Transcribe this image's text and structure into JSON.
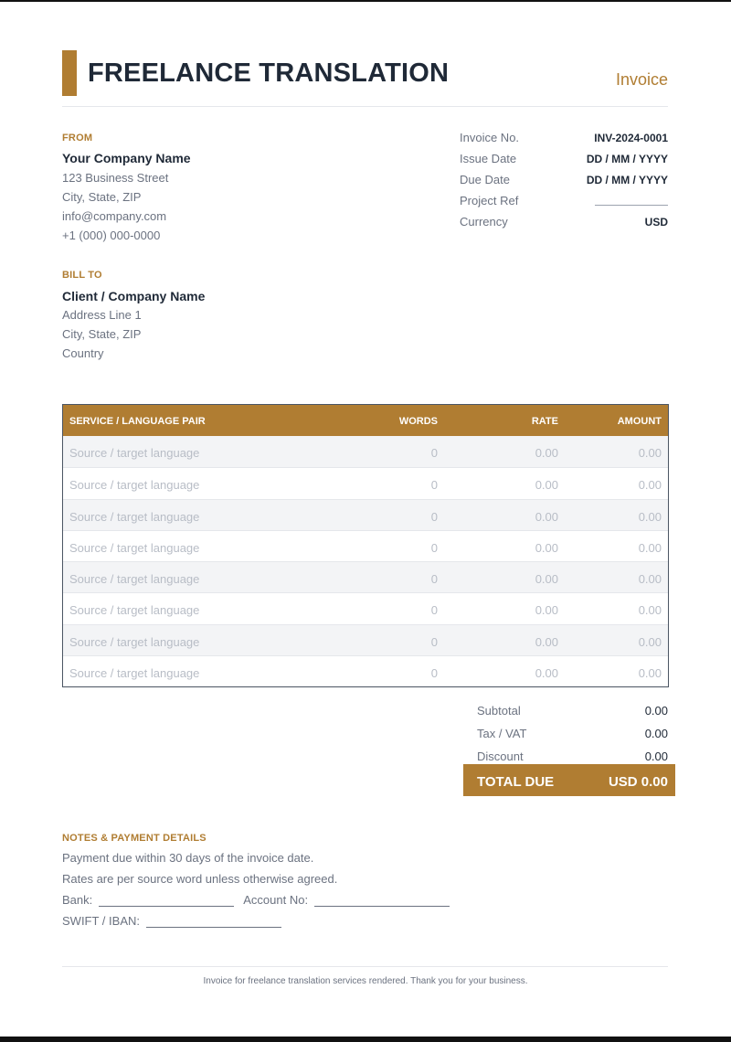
{
  "header": {
    "title": "FREELANCE TRANSLATION",
    "doc_label": "Invoice"
  },
  "from": {
    "label": "FROM",
    "name": "Your Company Name",
    "lines": [
      "123 Business Street",
      "City, State, ZIP",
      "info@company.com",
      "+1 (000) 000-0000"
    ]
  },
  "bill_to": {
    "label": "BILL TO",
    "name": "Client / Company Name",
    "lines": [
      "Address Line 1",
      "City, State, ZIP",
      "Country"
    ]
  },
  "meta": [
    {
      "label": "Invoice No.",
      "value": "INV-2024-0001"
    },
    {
      "label": "Issue Date",
      "value": "DD / MM / YYYY"
    },
    {
      "label": "Due Date",
      "value": "DD / MM / YYYY"
    },
    {
      "label": "Project Ref",
      "value": ""
    },
    {
      "label": "Currency",
      "value": "USD"
    }
  ],
  "table": {
    "headers": [
      "SERVICE / LANGUAGE PAIR",
      "WORDS",
      "RATE",
      "AMOUNT"
    ],
    "rows": [
      [
        "Source / target language",
        "0",
        "0.00",
        "0.00"
      ],
      [
        "Source / target language",
        "0",
        "0.00",
        "0.00"
      ],
      [
        "Source / target language",
        "0",
        "0.00",
        "0.00"
      ],
      [
        "Source / target language",
        "0",
        "0.00",
        "0.00"
      ],
      [
        "Source / target language",
        "0",
        "0.00",
        "0.00"
      ],
      [
        "Source / target language",
        "0",
        "0.00",
        "0.00"
      ],
      [
        "Source / target language",
        "0",
        "0.00",
        "0.00"
      ],
      [
        "Source / target language",
        "0",
        "0.00",
        "0.00"
      ]
    ]
  },
  "totals": {
    "subtotal_label": "Subtotal",
    "subtotal": "0.00",
    "tax_label": "Tax / VAT",
    "tax": "0.00",
    "discount_label": "Discount",
    "discount": "0.00",
    "total_label": "TOTAL DUE",
    "total": "USD 0.00"
  },
  "notes": {
    "label": "NOTES & PAYMENT DETAILS",
    "line1": "Payment due within 30 days of the invoice date.",
    "line2": "Rates are per source word unless otherwise agreed.",
    "bank_label": "Bank:",
    "account_label": "Account No:",
    "swift_label": "SWIFT / IBAN:"
  },
  "footer": {
    "text": "Invoice for freelance translation services rendered. Thank you for your business."
  },
  "colors": {
    "accent": "#b07d32",
    "text": "#1f2937",
    "muted": "#6b7280"
  }
}
